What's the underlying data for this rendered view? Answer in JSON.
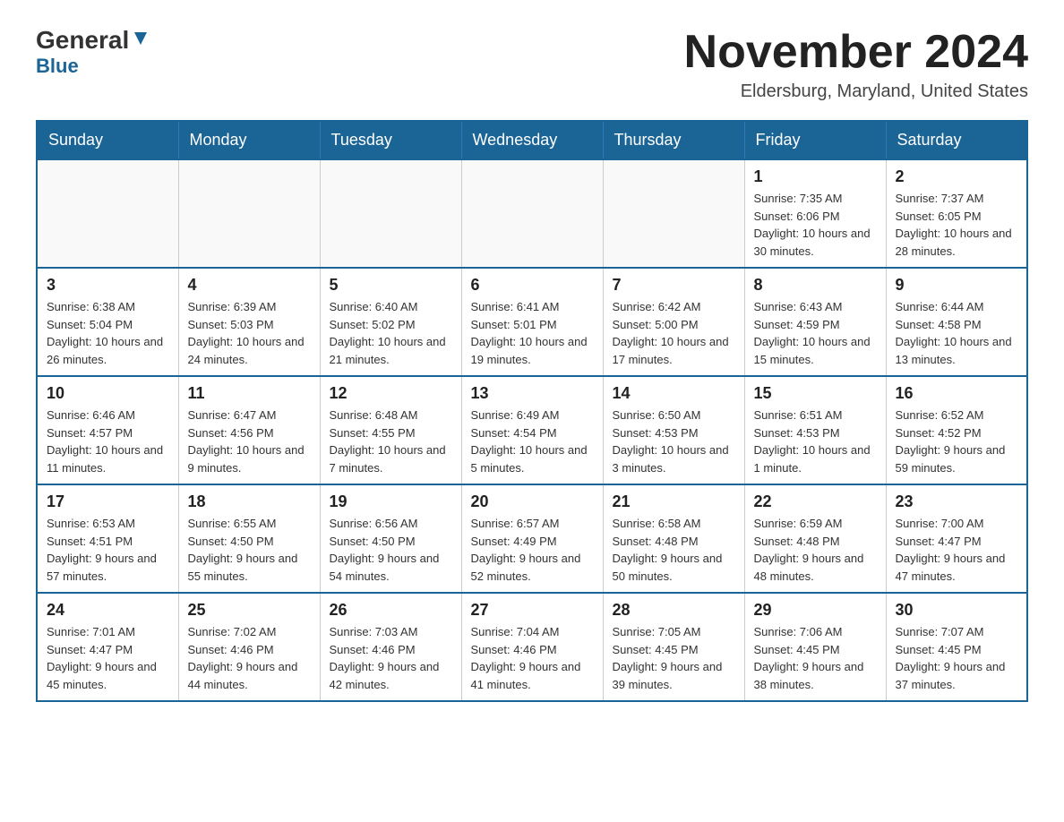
{
  "logo": {
    "general": "General",
    "blue": "Blue",
    "triangle_aria": "triangle"
  },
  "header": {
    "title": "November 2024",
    "location": "Eldersburg, Maryland, United States"
  },
  "days_of_week": [
    "Sunday",
    "Monday",
    "Tuesday",
    "Wednesday",
    "Thursday",
    "Friday",
    "Saturday"
  ],
  "weeks": [
    [
      {
        "day": "",
        "info": ""
      },
      {
        "day": "",
        "info": ""
      },
      {
        "day": "",
        "info": ""
      },
      {
        "day": "",
        "info": ""
      },
      {
        "day": "",
        "info": ""
      },
      {
        "day": "1",
        "info": "Sunrise: 7:35 AM\nSunset: 6:06 PM\nDaylight: 10 hours and 30 minutes."
      },
      {
        "day": "2",
        "info": "Sunrise: 7:37 AM\nSunset: 6:05 PM\nDaylight: 10 hours and 28 minutes."
      }
    ],
    [
      {
        "day": "3",
        "info": "Sunrise: 6:38 AM\nSunset: 5:04 PM\nDaylight: 10 hours and 26 minutes."
      },
      {
        "day": "4",
        "info": "Sunrise: 6:39 AM\nSunset: 5:03 PM\nDaylight: 10 hours and 24 minutes."
      },
      {
        "day": "5",
        "info": "Sunrise: 6:40 AM\nSunset: 5:02 PM\nDaylight: 10 hours and 21 minutes."
      },
      {
        "day": "6",
        "info": "Sunrise: 6:41 AM\nSunset: 5:01 PM\nDaylight: 10 hours and 19 minutes."
      },
      {
        "day": "7",
        "info": "Sunrise: 6:42 AM\nSunset: 5:00 PM\nDaylight: 10 hours and 17 minutes."
      },
      {
        "day": "8",
        "info": "Sunrise: 6:43 AM\nSunset: 4:59 PM\nDaylight: 10 hours and 15 minutes."
      },
      {
        "day": "9",
        "info": "Sunrise: 6:44 AM\nSunset: 4:58 PM\nDaylight: 10 hours and 13 minutes."
      }
    ],
    [
      {
        "day": "10",
        "info": "Sunrise: 6:46 AM\nSunset: 4:57 PM\nDaylight: 10 hours and 11 minutes."
      },
      {
        "day": "11",
        "info": "Sunrise: 6:47 AM\nSunset: 4:56 PM\nDaylight: 10 hours and 9 minutes."
      },
      {
        "day": "12",
        "info": "Sunrise: 6:48 AM\nSunset: 4:55 PM\nDaylight: 10 hours and 7 minutes."
      },
      {
        "day": "13",
        "info": "Sunrise: 6:49 AM\nSunset: 4:54 PM\nDaylight: 10 hours and 5 minutes."
      },
      {
        "day": "14",
        "info": "Sunrise: 6:50 AM\nSunset: 4:53 PM\nDaylight: 10 hours and 3 minutes."
      },
      {
        "day": "15",
        "info": "Sunrise: 6:51 AM\nSunset: 4:53 PM\nDaylight: 10 hours and 1 minute."
      },
      {
        "day": "16",
        "info": "Sunrise: 6:52 AM\nSunset: 4:52 PM\nDaylight: 9 hours and 59 minutes."
      }
    ],
    [
      {
        "day": "17",
        "info": "Sunrise: 6:53 AM\nSunset: 4:51 PM\nDaylight: 9 hours and 57 minutes."
      },
      {
        "day": "18",
        "info": "Sunrise: 6:55 AM\nSunset: 4:50 PM\nDaylight: 9 hours and 55 minutes."
      },
      {
        "day": "19",
        "info": "Sunrise: 6:56 AM\nSunset: 4:50 PM\nDaylight: 9 hours and 54 minutes."
      },
      {
        "day": "20",
        "info": "Sunrise: 6:57 AM\nSunset: 4:49 PM\nDaylight: 9 hours and 52 minutes."
      },
      {
        "day": "21",
        "info": "Sunrise: 6:58 AM\nSunset: 4:48 PM\nDaylight: 9 hours and 50 minutes."
      },
      {
        "day": "22",
        "info": "Sunrise: 6:59 AM\nSunset: 4:48 PM\nDaylight: 9 hours and 48 minutes."
      },
      {
        "day": "23",
        "info": "Sunrise: 7:00 AM\nSunset: 4:47 PM\nDaylight: 9 hours and 47 minutes."
      }
    ],
    [
      {
        "day": "24",
        "info": "Sunrise: 7:01 AM\nSunset: 4:47 PM\nDaylight: 9 hours and 45 minutes."
      },
      {
        "day": "25",
        "info": "Sunrise: 7:02 AM\nSunset: 4:46 PM\nDaylight: 9 hours and 44 minutes."
      },
      {
        "day": "26",
        "info": "Sunrise: 7:03 AM\nSunset: 4:46 PM\nDaylight: 9 hours and 42 minutes."
      },
      {
        "day": "27",
        "info": "Sunrise: 7:04 AM\nSunset: 4:46 PM\nDaylight: 9 hours and 41 minutes."
      },
      {
        "day": "28",
        "info": "Sunrise: 7:05 AM\nSunset: 4:45 PM\nDaylight: 9 hours and 39 minutes."
      },
      {
        "day": "29",
        "info": "Sunrise: 7:06 AM\nSunset: 4:45 PM\nDaylight: 9 hours and 38 minutes."
      },
      {
        "day": "30",
        "info": "Sunrise: 7:07 AM\nSunset: 4:45 PM\nDaylight: 9 hours and 37 minutes."
      }
    ]
  ]
}
